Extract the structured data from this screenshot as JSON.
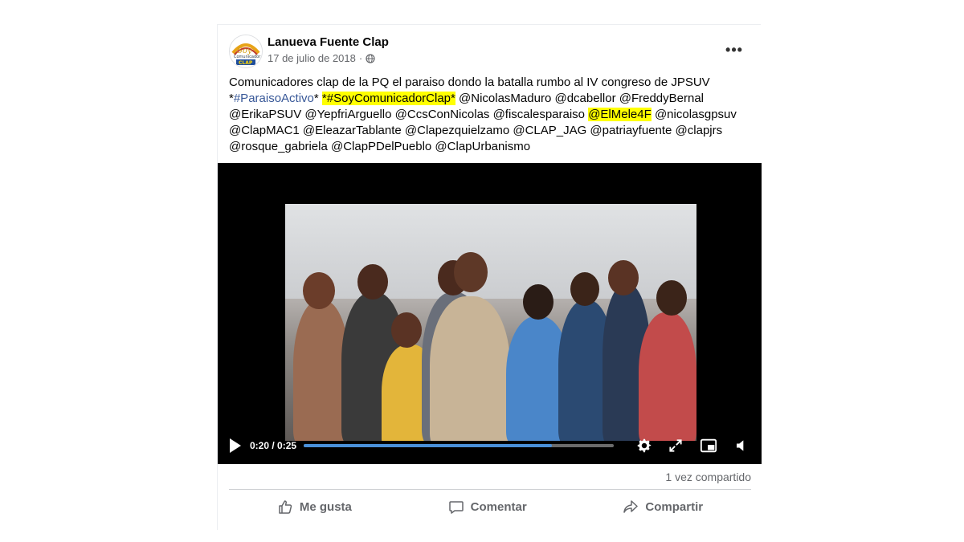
{
  "post": {
    "author": "Lanueva Fuente Clap",
    "date": "17 de julio de 2018",
    "separator": "·",
    "more_label": "•••",
    "text_lines": [
      [
        {
          "t": "Comunicadores clap de la PQ el  paraiso dondo la batalla rumbo al IV congreso de JPSUV",
          "k": "plain"
        }
      ],
      [
        {
          "t": "*",
          "k": "plain"
        },
        {
          "t": "#ParaisoActivo",
          "k": "tag"
        },
        {
          "t": "* ",
          "k": "plain"
        },
        {
          "t": "*#SoyComunicadorClap*",
          "k": "hl"
        },
        {
          "t": " @NicolasMaduro @dcabellor @FreddyBernal",
          "k": "plain"
        }
      ],
      [
        {
          "t": "@ErikaPSUV @YepfriArguello @CcsConNicolas @fiscalesparaiso ",
          "k": "plain"
        },
        {
          "t": "@ElMele4F",
          "k": "hl"
        },
        {
          "t": " @nicolasgpsuv",
          "k": "plain"
        }
      ],
      [
        {
          "t": "@ClapMAC1 @EleazarTablante @Clapezquielzamo @CLAP_JAG  @patriayfuente @clapjrs",
          "k": "plain"
        }
      ],
      [
        {
          "t": "@rosque_gabriela @ClapPDelPueblo @ClapUrbanismo",
          "k": "plain"
        }
      ]
    ]
  },
  "video": {
    "time": "0:20 / 0:25",
    "progress_fraction": 0.8,
    "accent": "#4a90d9"
  },
  "engagement": {
    "shares": "1 vez compartido"
  },
  "actions": {
    "like": "Me gusta",
    "comment": "Comentar",
    "share": "Compartir"
  },
  "icons": {
    "avatar": "soy-comunicador-clap-logo",
    "privacy": "globe-icon",
    "like": "thumbs-up-icon",
    "comment": "speech-bubble-icon",
    "share": "share-arrow-icon"
  }
}
